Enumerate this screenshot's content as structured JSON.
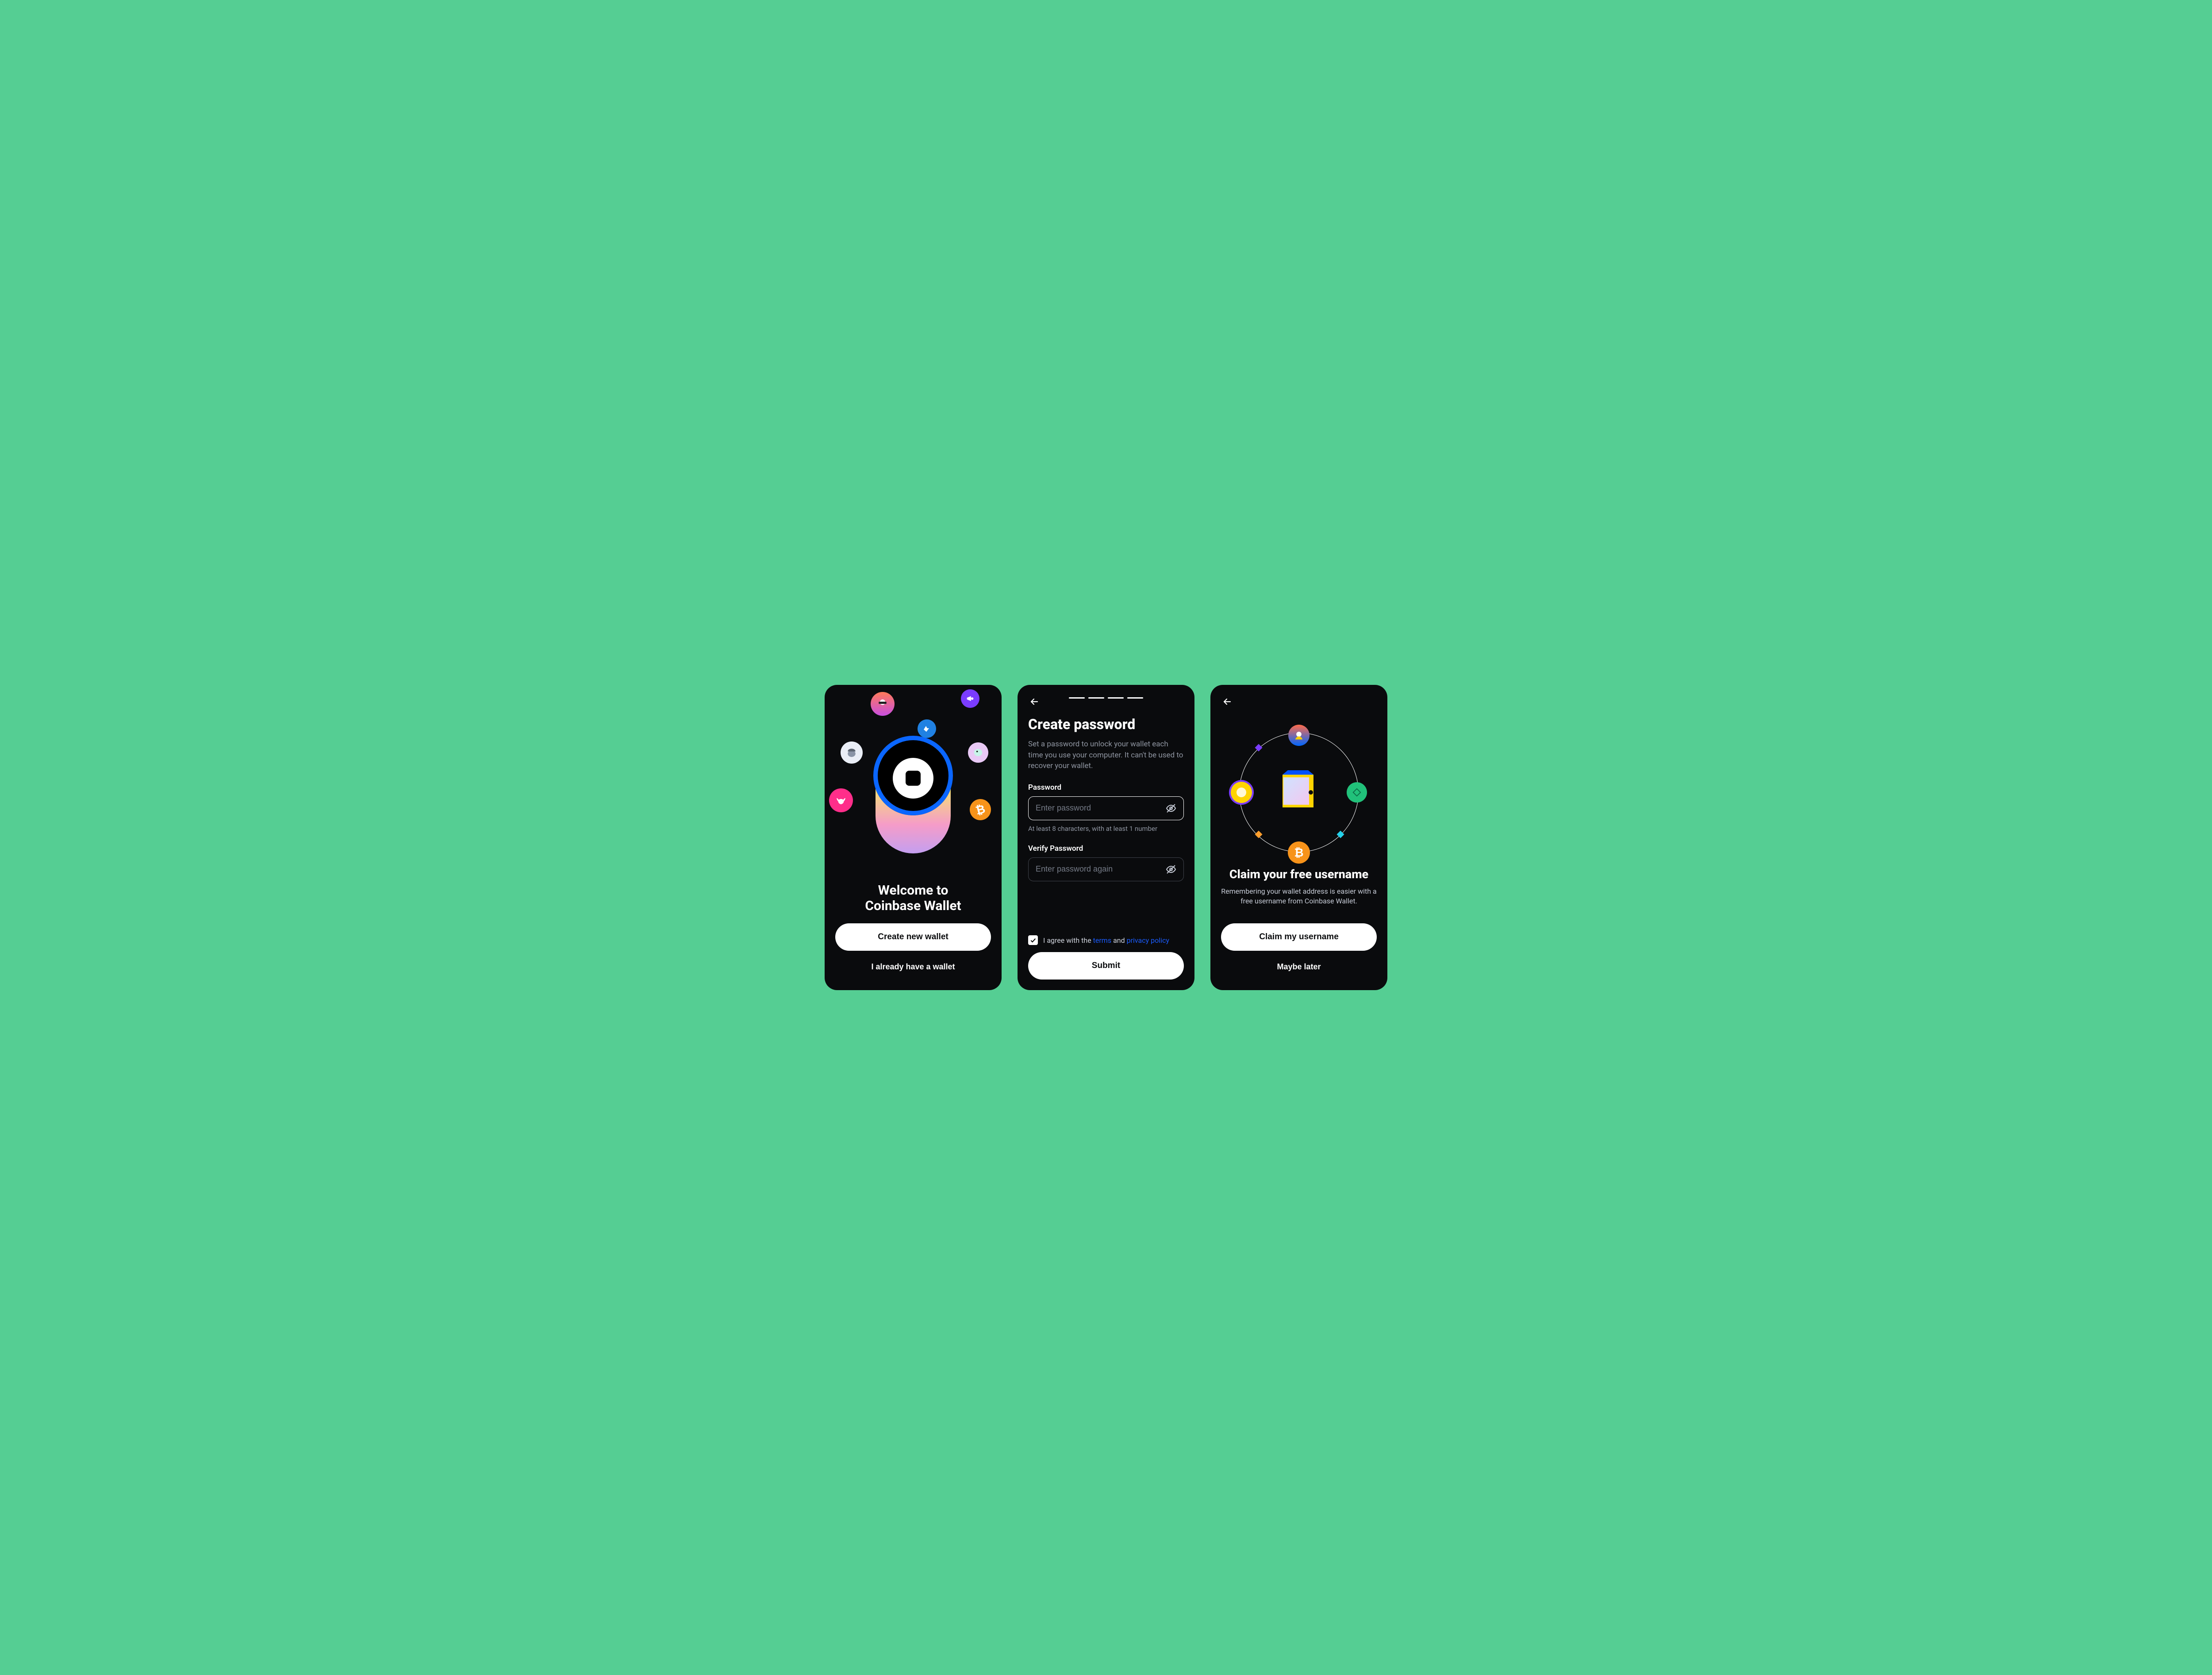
{
  "colors": {
    "accent_blue": "#1a5cff",
    "bg": "#0a0b0d",
    "page_bg": "#55ce93"
  },
  "screen1": {
    "title_line1": "Welcome to",
    "title_line2": "Coinbase Wallet",
    "primary_cta": "Create new wallet",
    "secondary_cta": "I already have a wallet",
    "orbs": {
      "count": 6,
      "top_left": "avatar-sunglasses",
      "top_right": "megaphone-purple",
      "mid_left": "ape-cap",
      "mid_right_small": "nft-bird",
      "bottom_left": "bull-pink",
      "bottom_right": "bitcoin-orange"
    }
  },
  "screen2": {
    "heading": "Create password",
    "description": "Set a password to unlock your wallet each time you use your computer. It can't be used to recover your wallet.",
    "password_label": "Password",
    "password_placeholder": "Enter password",
    "password_hint": "At least 8 characters, with at least 1 number",
    "verify_label": "Verify Password",
    "verify_placeholder": "Enter password again",
    "consent_prefix": "I agree with the ",
    "consent_terms": "terms",
    "consent_mid": " and ",
    "consent_privacy": "privacy policy",
    "consent_checked": true,
    "submit_label": "Submit",
    "progress_steps": 4
  },
  "screen3": {
    "heading": "Claim your free username",
    "description": "Remembering your wallet address is easier with a free username from Coinbase Wallet.",
    "primary_cta": "Claim my username",
    "secondary_cta": "Maybe later",
    "orbit_items": {
      "top": "avatar-nft",
      "right": "diamond-green",
      "bottom": "bitcoin-orange",
      "left": "coin-yellow",
      "diamonds": [
        "purple",
        "orange",
        "cyan"
      ]
    }
  }
}
